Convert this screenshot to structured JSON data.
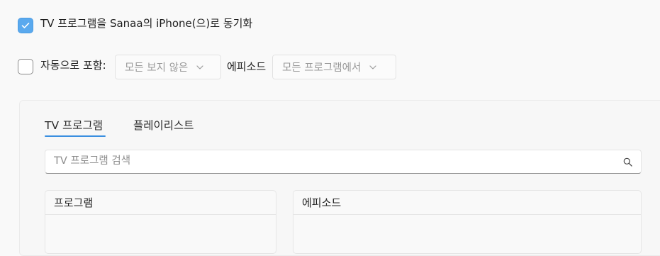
{
  "sync": {
    "label": "TV 프로그램을 Sanaa의 iPhone(으)로 동기화",
    "checked": true
  },
  "auto_include": {
    "label": "자동으로 포함:",
    "checked": false,
    "when_value": "모든 보지 않은",
    "episodes_label": "에피소드",
    "source_value": "모든 프로그램에서"
  },
  "tabs": [
    {
      "label": "TV 프로그램",
      "selected": true
    },
    {
      "label": "플레이리스트",
      "selected": false
    }
  ],
  "search": {
    "placeholder": "TV 프로그램 검색",
    "value": ""
  },
  "columns": {
    "programs_header": "프로그램",
    "episodes_header": "에피소드"
  },
  "colors": {
    "accent": "#5aa9ee",
    "tab_underline": "#3a8fe0",
    "background": "#f9f9f9"
  },
  "icons": {
    "checkmark": "checkmark-icon",
    "chevron": "chevron-down-icon",
    "search": "search-icon"
  }
}
